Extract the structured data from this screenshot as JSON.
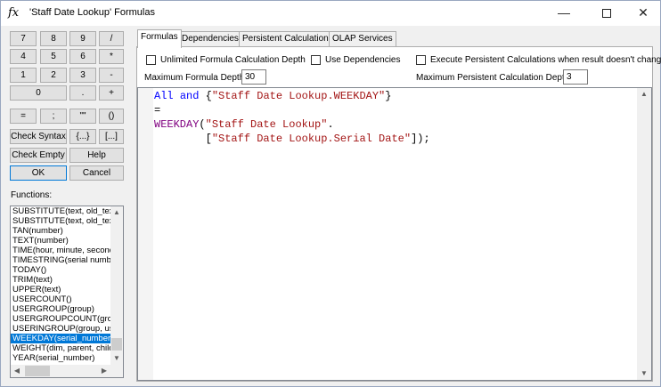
{
  "window": {
    "title": "'Staff Date Lookup' Formulas",
    "icon": "fx",
    "minimize": "—",
    "close": "✕"
  },
  "keypad": [
    [
      "7",
      "8",
      "9",
      "/"
    ],
    [
      "4",
      "5",
      "6",
      "*"
    ],
    [
      "1",
      "2",
      "3",
      "-"
    ],
    [
      "0",
      ".",
      "+"
    ],
    [
      "=",
      ";",
      "\"\"",
      "()"
    ]
  ],
  "buttons": {
    "check_syntax": "Check Syntax",
    "braces": "{...}",
    "brackets": "[...]",
    "check_empty": "Check Empty",
    "help": "Help",
    "ok": "OK",
    "cancel": "Cancel"
  },
  "functions_label": "Functions:",
  "functions": [
    "SUBSTITUTE(text, old_text",
    "SUBSTITUTE(text, old_tex",
    "TAN(number)",
    "TEXT(number)",
    "TIME(hour, minute, second",
    "TIMESTRING(serial numbe",
    "TODAY()",
    "TRIM(text)",
    "UPPER(text)",
    "USERCOUNT()",
    "USERGROUP(group)",
    "USERGROUPCOUNT(grou",
    "USERINGROUP(group, us",
    "WEEKDAY(serial_number)",
    "WEIGHT(dim, parent, child",
    "YEAR(serial_number)"
  ],
  "selected_function": "WEEKDAY(serial_number)",
  "tabs": [
    "Formulas",
    "Dependencies",
    "Persistent Calculations",
    "OLAP Services"
  ],
  "options": {
    "unlimited_depth": "Unlimited Formula Calculation Depth",
    "use_dependencies": "Use Dependencies",
    "execute_persistent": "Execute Persistent Calculations when result doesn't change",
    "max_formula_depth_label": "Maximum Formula Depth:",
    "max_formula_depth": "30",
    "max_persistent_depth_label": "Maximum Persistent Calculation Depth:",
    "max_persistent_depth": "3"
  },
  "code": {
    "l1_kw1": "All",
    "l1_kw2": "and",
    "l1_brace_open": "{",
    "l1_str": "\"Staff Date Lookup.WEEKDAY\"",
    "l1_brace_close": "}",
    "l2": "=",
    "l3_fn": "WEEKDAY",
    "l3_paren": "(",
    "l3_str": "\"Staff Date Lookup\"",
    "l3_dot": ".",
    "l4_indent": "        ",
    "l4_open": "[",
    "l4_str": "\"Staff Date Lookup.Serial Date\"",
    "l4_close": "]);"
  }
}
